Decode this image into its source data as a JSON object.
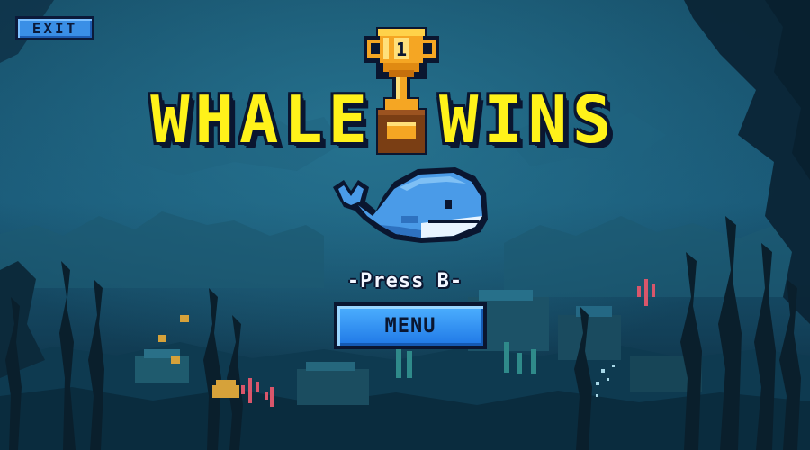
{
  "exit_button": {
    "label": "EXIT"
  },
  "title": {
    "left_word": "WHALE",
    "right_word": "WINS"
  },
  "trophy": {
    "place_number": "1"
  },
  "prompt": {
    "text": "-Press B-"
  },
  "menu_button": {
    "label": "MENU"
  },
  "colors": {
    "title_yellow": "#fff21a",
    "button_blue": "#3a8fe6",
    "outline_dark": "#0a1630",
    "water_deep": "#0d2a3f",
    "whale_blue": "#4a9be8"
  },
  "icons": {
    "trophy": "trophy-icon",
    "whale": "whale-character"
  }
}
